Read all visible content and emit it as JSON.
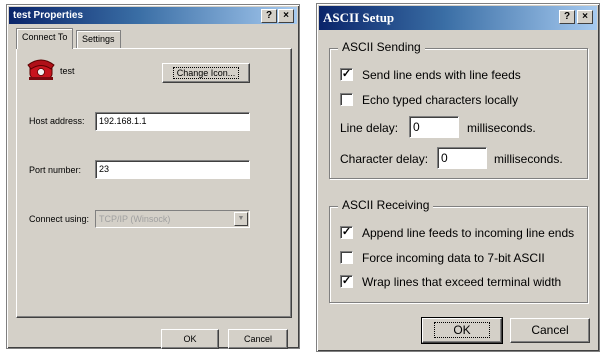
{
  "left_dialog": {
    "title": "test Properties",
    "help_btn": "?",
    "close_btn": "×",
    "tabs": [
      "Connect To",
      "Settings"
    ],
    "connection_name": "test",
    "change_icon_btn": "Change Icon...",
    "host_label": "Host address:",
    "host_value": "192.168.1.1",
    "port_label": "Port number:",
    "port_value": "23",
    "connect_label": "Connect using:",
    "connect_value": "TCP/IP (Winsock)",
    "ok_btn": "OK",
    "cancel_btn": "Cancel"
  },
  "right_dialog": {
    "title": "ASCII Setup",
    "help_btn": "?",
    "close_btn": "×",
    "sending": {
      "legend": "ASCII Sending",
      "send_line_ends": {
        "label": "Send line ends with line feeds",
        "checked": true
      },
      "echo_typed": {
        "label": "Echo typed characters locally",
        "checked": false
      },
      "line_delay_label": "Line delay:",
      "line_delay_value": "0",
      "line_delay_unit": "milliseconds.",
      "char_delay_label": "Character delay:",
      "char_delay_value": "0",
      "char_delay_unit": "milliseconds."
    },
    "receiving": {
      "legend": "ASCII Receiving",
      "append_line_feeds": {
        "label": "Append line feeds to incoming line ends",
        "checked": true
      },
      "force_7bit": {
        "label": "Force incoming data to 7-bit ASCII",
        "checked": false
      },
      "wrap_lines": {
        "label": "Wrap lines that exceed terminal width",
        "checked": true
      }
    },
    "ok_btn": "OK",
    "cancel_btn": "Cancel"
  }
}
